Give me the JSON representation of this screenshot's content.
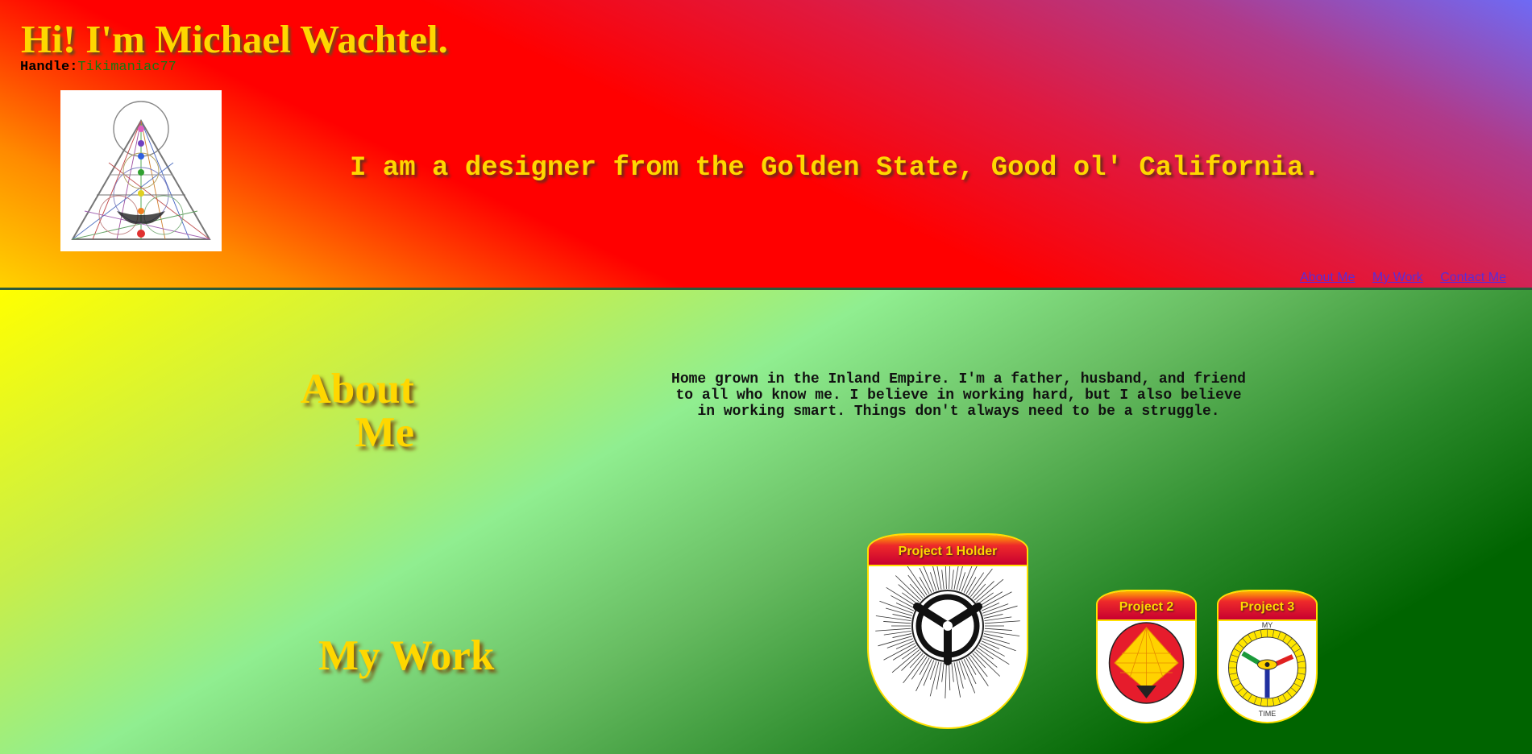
{
  "header": {
    "title": "Hi! I'm Michael Wachtel.",
    "handle_label": "Handle:",
    "handle_value": "Tikimaniac77",
    "tagline": "I am a designer from the Golden State, Good ol' California.",
    "avatar_icon": "sacred-geometry-triangle-icon"
  },
  "nav": {
    "items": [
      {
        "label": "About Me"
      },
      {
        "label": "My Work"
      },
      {
        "label": "Contact Me"
      }
    ]
  },
  "about": {
    "heading": "About Me",
    "text": "Home grown in the Inland Empire. I'm a father, husband, and friend to all who know me. I believe in working hard, but I also believe in working smart. Things don't always need to be a struggle."
  },
  "work": {
    "heading": "My Work",
    "projects": [
      {
        "title": "Project 1 Holder",
        "icon": "sunburst-emblem-icon"
      },
      {
        "title": "Project 2",
        "icon": "diamond-pyramid-emblem-icon"
      },
      {
        "title": "Project 3",
        "icon": "why-time-eye-emblem-icon",
        "ring_top": "MY",
        "ring_bottom": "TIME"
      }
    ]
  },
  "colors": {
    "gold": "#ffd700",
    "nav_link": "#5a2cd6",
    "handle": "#127a12"
  }
}
